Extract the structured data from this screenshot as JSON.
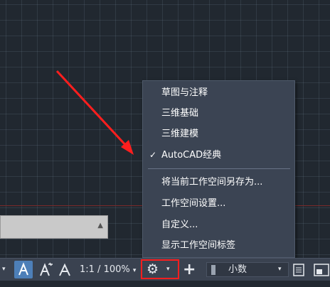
{
  "workspace_menu": {
    "items": [
      {
        "label": "草图与注释",
        "checked": false
      },
      {
        "label": "三维基础",
        "checked": false
      },
      {
        "label": "三维建模",
        "checked": false
      },
      {
        "label": "AutoCAD经典",
        "checked": true
      },
      {
        "label": "将当前工作空间另存为...",
        "checked": false
      },
      {
        "label": "工作空间设置...",
        "checked": false
      },
      {
        "label": "自定义...",
        "checked": false
      },
      {
        "label": "显示工作空间标签",
        "checked": false
      }
    ],
    "check_glyph": "✓"
  },
  "statusbar": {
    "annotation_scale": "1:1 / 100%",
    "units": "小数",
    "dropdown_glyph": "▾",
    "plus_glyph": "+",
    "gear_glyph": "⚙"
  },
  "command_line": {
    "arrow_glyph": "▲"
  },
  "highlight_color": "#ff1e1e"
}
